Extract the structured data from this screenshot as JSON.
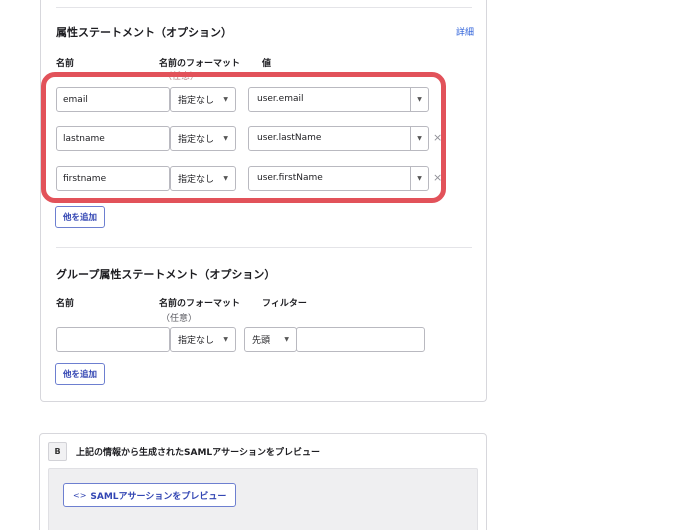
{
  "attribute_section": {
    "title": "属性ステートメント（オプション）",
    "detail_link": "詳細",
    "col_name": "名前",
    "col_format": "名前のフォーマット",
    "col_format_sub": "（任意）",
    "col_value": "値",
    "rows": [
      {
        "name": "email",
        "format": "指定なし",
        "value": "user.email",
        "removable": false
      },
      {
        "name": "lastname",
        "format": "指定なし",
        "value": "user.lastName",
        "removable": true
      },
      {
        "name": "firstname",
        "format": "指定なし",
        "value": "user.firstName",
        "removable": true
      }
    ],
    "add_label": "他を追加"
  },
  "group_section": {
    "title": "グループ属性ステートメント（オプション）",
    "col_name": "名前",
    "col_format": "名前のフォーマット",
    "col_format_sub": "（任意）",
    "col_filter": "フィルター",
    "row": {
      "name": "",
      "format": "指定なし",
      "filter_type": "先頭",
      "filter_value": ""
    },
    "add_label": "他を追加"
  },
  "preview_section": {
    "badge": "B",
    "title": "上記の情報から生成されたSAMLアサーションをプレビュー",
    "button_icon": "<>",
    "button_label": "SAMLアサーションをプレビュー"
  },
  "icons": {
    "remove": "×",
    "caret": "▼"
  },
  "colors": {
    "highlight": "#e2525a",
    "link": "#2b5fd9",
    "button_text": "#3346b3",
    "button_border": "#6d7fd0"
  }
}
